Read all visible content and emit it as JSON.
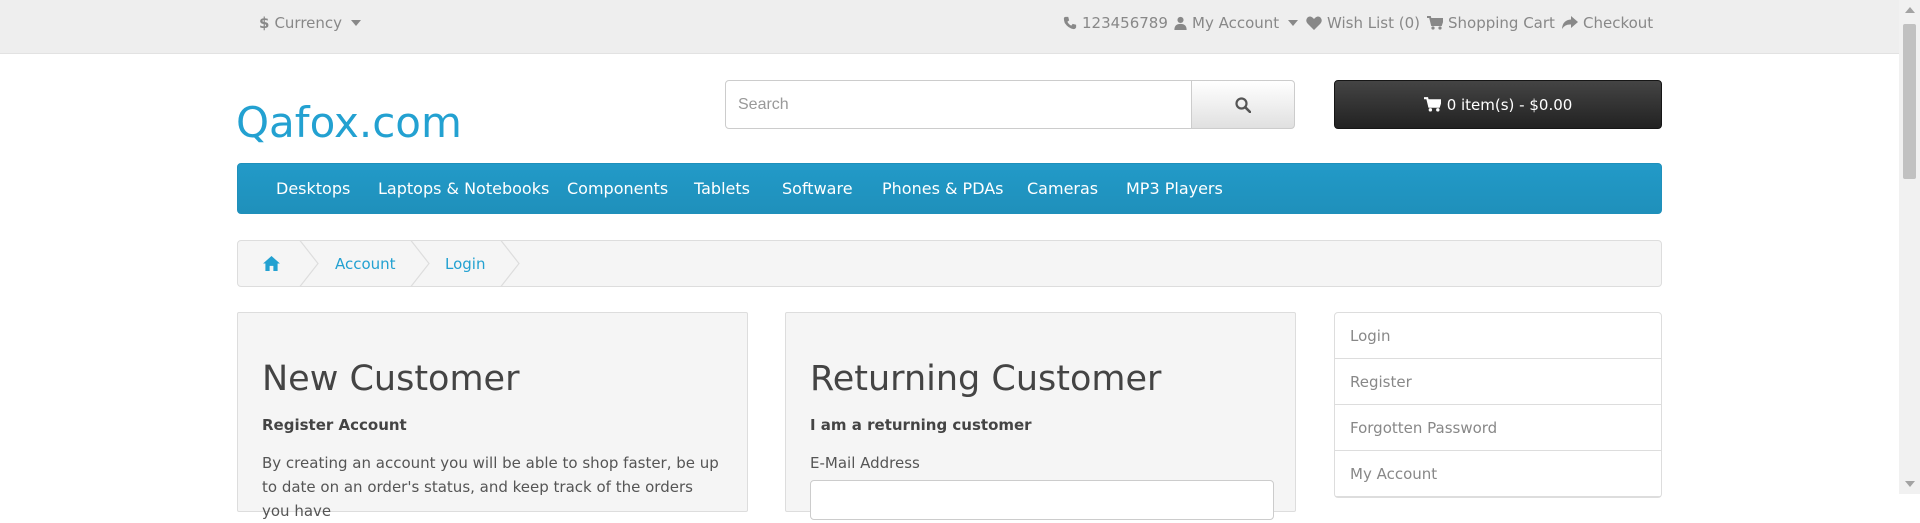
{
  "topbar": {
    "currency_label": "Currency",
    "currency_symbol": "$",
    "phone": "123456789",
    "my_account": "My Account",
    "wishlist": "Wish List (0)",
    "shopping_cart": "Shopping Cart",
    "checkout": "Checkout"
  },
  "header": {
    "brand": "Qafox.com",
    "search_placeholder": "Search",
    "cart_summary": "0 item(s) - $0.00"
  },
  "menu": {
    "items": [
      "Desktops",
      "Laptops & Notebooks",
      "Components",
      "Tablets",
      "Software",
      "Phones & PDAs",
      "Cameras",
      "MP3 Players"
    ]
  },
  "breadcrumb": {
    "items": [
      "Account",
      "Login"
    ]
  },
  "new_customer": {
    "title": "New Customer",
    "subtitle": "Register Account",
    "text": "By creating an account you will be able to shop faster, be up to date on an order's status, and keep track of the orders you have"
  },
  "returning_customer": {
    "title": "Returning Customer",
    "subtitle": "I am a returning customer",
    "email_label": "E-Mail Address"
  },
  "sidebar": {
    "items": [
      "Login",
      "Register",
      "Forgotten Password",
      "My Account"
    ]
  },
  "colors": {
    "brand": "#23a1d1",
    "menu": "#229ac8",
    "cart_button": "#333333"
  }
}
